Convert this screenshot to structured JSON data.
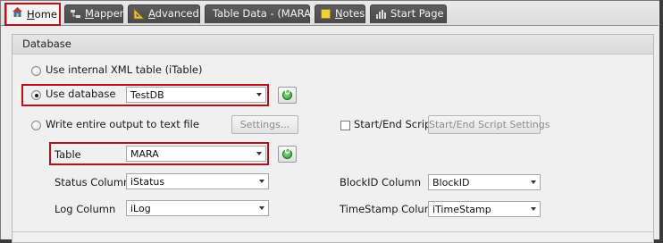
{
  "tabs": [
    {
      "label": "Home",
      "underline": "H",
      "rest": "ome",
      "icon": "home-icon"
    },
    {
      "label": "Mapper",
      "underline": "M",
      "rest": "apper",
      "icon": "mapper-icon"
    },
    {
      "label": "Advanced",
      "underline": "A",
      "rest": "dvanced",
      "icon": "triangle-ruler-icon"
    },
    {
      "label": "Table Data - (MARA)",
      "icon": "none"
    },
    {
      "label": "Notes",
      "underline": "N",
      "rest": "otes",
      "icon": "note-icon"
    },
    {
      "label": "Start Page",
      "icon": "start-page-icon"
    }
  ],
  "panel": {
    "title": "Database",
    "option_internal": "Use internal XML table (iTable)",
    "option_database": "Use database",
    "database_value": "TestDB",
    "option_textfile": "Write entire output to text file",
    "settings_button": "Settings...",
    "startend_checkbox": "Start/End Script",
    "startend_button": "Start/End Script Settings",
    "table_label": "Table",
    "table_value": "MARA",
    "status_label": "Status Column",
    "status_value": "iStatus",
    "log_label": "Log Column",
    "log_value": "iLog",
    "blockid_label": "BlockID Column",
    "blockid_value": "BlockID",
    "timestamp_label": "TimeStamp Column",
    "timestamp_value": "iTimeStamp"
  },
  "colors": {
    "highlight": "#b8101a",
    "refresh_green": "#2b9a2b"
  }
}
